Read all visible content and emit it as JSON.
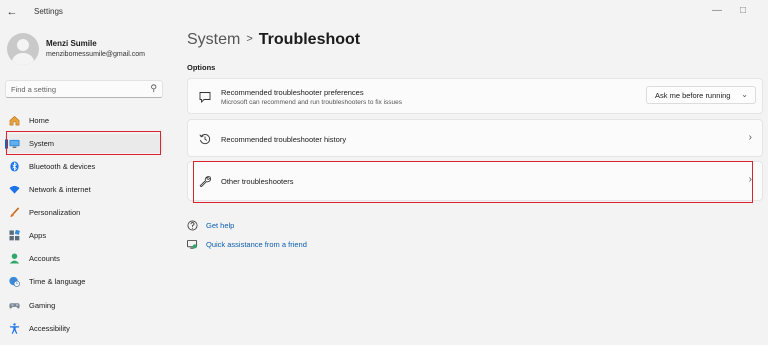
{
  "window": {
    "app_title": "Settings",
    "back_icon": "back-arrow-icon",
    "minimize_icon": "minimize-icon",
    "maximize_icon": "maximize-icon"
  },
  "profile": {
    "name": "Menzi Sumile",
    "email": "menzibomessumile@gmail.com"
  },
  "search": {
    "placeholder": "Find a setting",
    "value": ""
  },
  "sidebar": {
    "items": [
      {
        "label": "Home",
        "icon": "home-icon"
      },
      {
        "label": "System",
        "icon": "monitor-icon",
        "active": true
      },
      {
        "label": "Bluetooth & devices",
        "icon": "bluetooth-icon"
      },
      {
        "label": "Network & internet",
        "icon": "wifi-icon"
      },
      {
        "label": "Personalization",
        "icon": "brush-icon"
      },
      {
        "label": "Apps",
        "icon": "apps-icon"
      },
      {
        "label": "Accounts",
        "icon": "person-icon"
      },
      {
        "label": "Time & language",
        "icon": "globe-clock-icon"
      },
      {
        "label": "Gaming",
        "icon": "gamepad-icon"
      },
      {
        "label": "Accessibility",
        "icon": "accessibility-icon"
      }
    ]
  },
  "main": {
    "breadcrumb_parent": "System",
    "breadcrumb_separator": ">",
    "page_title": "Troubleshoot",
    "section_label": "Options",
    "cards": [
      {
        "title": "Recommended troubleshooter preferences",
        "description": "Microsoft can recommend and run troubleshooters to fix issues",
        "icon": "chat-bubble-icon",
        "dropdown_value": "Ask me before running"
      },
      {
        "title": "Recommended troubleshooter history",
        "icon": "history-icon"
      },
      {
        "title": "Other troubleshooters",
        "icon": "wrench-icon"
      }
    ],
    "links": [
      {
        "label": "Get help",
        "icon": "help-icon"
      },
      {
        "label": "Quick assistance from a friend",
        "icon": "remote-assist-icon"
      }
    ]
  },
  "colors": {
    "accent": "#0067c0",
    "highlight_border": "#d9232d",
    "link": "#0b5cad"
  }
}
